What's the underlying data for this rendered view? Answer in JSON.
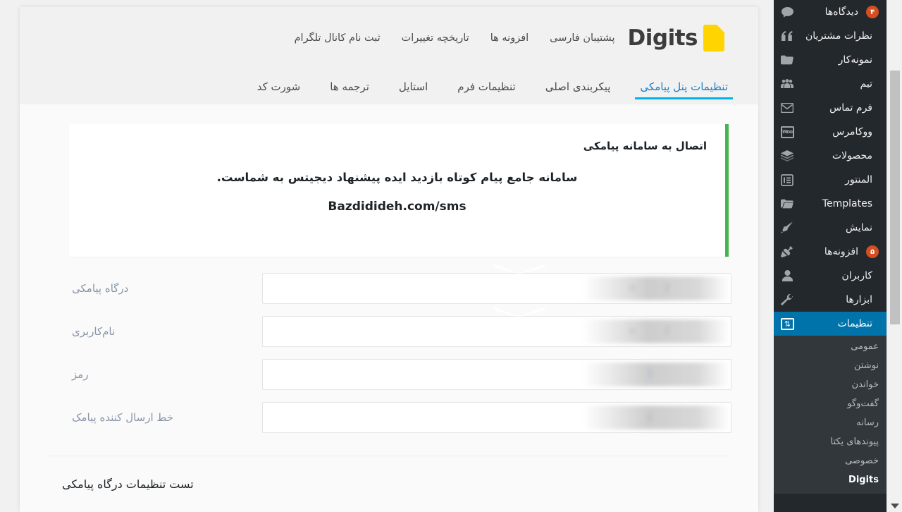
{
  "brand": {
    "logo_text": "Digits",
    "logo_mark": "yellow-page-icon"
  },
  "header": {
    "links": [
      {
        "label": "ثبت نام کانال تلگرام"
      },
      {
        "label": "تاریخچه تغییرات"
      },
      {
        "label": "افزونه ها"
      },
      {
        "label": "پشتیبان فارسی"
      }
    ]
  },
  "tabs": [
    {
      "label": "شورت کد",
      "active": false
    },
    {
      "label": "ترجمه ها",
      "active": false
    },
    {
      "label": "استایل",
      "active": false
    },
    {
      "label": "تنظیمات فرم",
      "active": false
    },
    {
      "label": "پیکربندی اصلی",
      "active": false
    },
    {
      "label": "تنظیمات پنل پیامکی",
      "active": true
    }
  ],
  "notice": {
    "title": "اتصال به سامانه پیامکی",
    "body": "سامانه جامع پیام کوتاه بازدید ایده پیشنهاد دیجیتس به شماست.",
    "url": "Bazdidideh.com/sms",
    "accent_color": "#46b450"
  },
  "form": {
    "fields": [
      {
        "label": "درگاه پیامکی",
        "value": "",
        "placeholder": "",
        "masked_text": "n 2",
        "masked": true,
        "chevron": true
      },
      {
        "label": "نام‌کاربری",
        "value": "",
        "placeholder": "",
        "masked_text": "n 2",
        "masked": true,
        "chevron": true
      },
      {
        "label": "رمز",
        "value": "",
        "placeholder": "",
        "masked_text": "3",
        "masked": true,
        "password": true,
        "chevron": false
      },
      {
        "label": "خط ارسال کننده پیامک",
        "value": "",
        "placeholder": "",
        "masked_text": "2",
        "masked": true,
        "chevron": false
      }
    ]
  },
  "section": {
    "test_title": "تست تنظیمات درگاه پیامکی"
  },
  "sidebar": {
    "items": [
      {
        "label": "دیدگاه‌ها",
        "icon": "comment-icon",
        "badge": "۴",
        "active": false
      },
      {
        "label": "نظرات مشتریان",
        "icon": "quote-icon",
        "badge": "",
        "active": false
      },
      {
        "label": "نمونه‌کار",
        "icon": "portfolio-folder-icon",
        "badge": "",
        "active": false
      },
      {
        "label": "تیم",
        "icon": "group-users-icon",
        "badge": "",
        "active": false
      },
      {
        "label": "فرم تماس",
        "icon": "envelope-icon",
        "badge": "",
        "active": false
      },
      {
        "label": "ووکامرس",
        "icon": "woo-icon",
        "badge": "",
        "active": false
      },
      {
        "label": "محصولات",
        "icon": "products-box-icon",
        "badge": "",
        "active": false
      },
      {
        "label": "المنتور",
        "icon": "elementor-icon",
        "badge": "",
        "active": false
      },
      {
        "label": "Templates",
        "icon": "templates-folder-icon",
        "badge": "",
        "active": false
      },
      {
        "label": "نمایش",
        "icon": "appearance-brush-icon",
        "badge": "",
        "active": false
      },
      {
        "label": "افزونه‌ها",
        "icon": "plugin-icon",
        "badge": "۵",
        "active": false
      },
      {
        "label": "کاربران",
        "icon": "user-icon",
        "badge": "",
        "active": false
      },
      {
        "label": "ابزارها",
        "icon": "tools-wrench-icon",
        "badge": "",
        "active": false
      },
      {
        "label": "تنظیمات",
        "icon": "settings-sliders-icon",
        "badge": "",
        "active": true
      }
    ],
    "submenu": [
      {
        "label": "عمومی",
        "current": false
      },
      {
        "label": "نوشتن",
        "current": false
      },
      {
        "label": "خواندن",
        "current": false
      },
      {
        "label": "گفت‌وگو",
        "current": false
      },
      {
        "label": "رسانه",
        "current": false
      },
      {
        "label": "پیوندهای یکتا",
        "current": false
      },
      {
        "label": "خصوصی",
        "current": false
      },
      {
        "label": "Digits",
        "current": true
      }
    ],
    "active_color": "#0073aa",
    "bg_color": "#23282d",
    "badge_color": "#d54e21"
  },
  "scrollbar": {
    "down_arrow": "chevron-down-icon"
  }
}
